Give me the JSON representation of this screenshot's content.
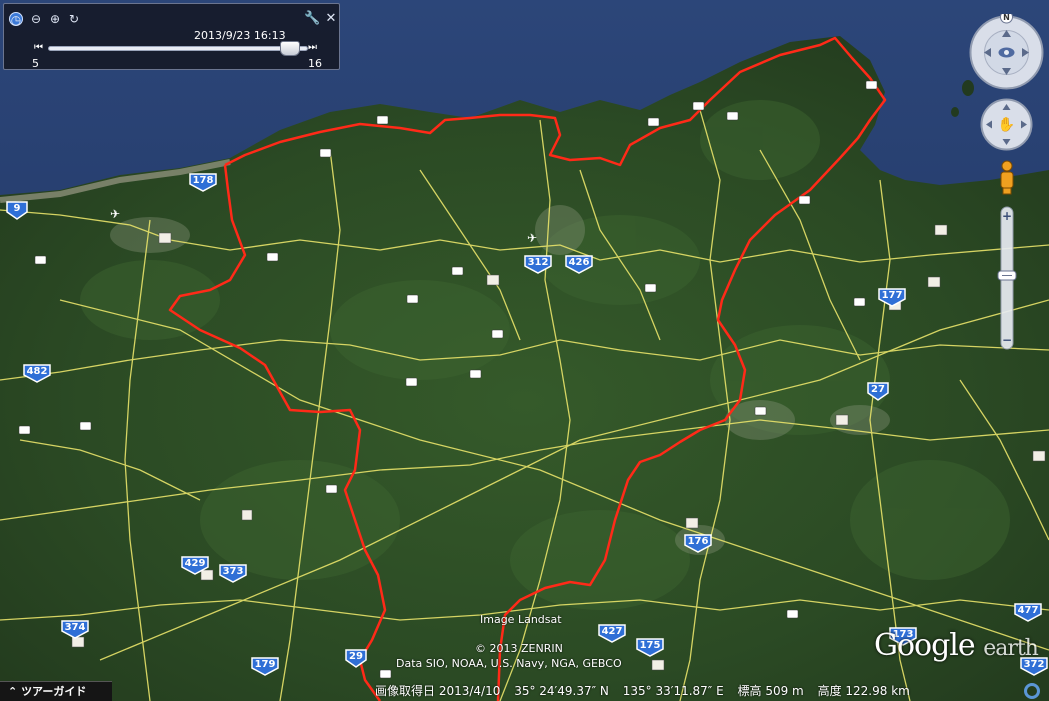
{
  "time_slider": {
    "date": "2013/9/23  16:13",
    "min_label": "5",
    "max_label": "16",
    "position": 0.93
  },
  "markers": {
    "routes": [
      "9",
      "178",
      "312",
      "426",
      "177",
      "482",
      "27",
      "429",
      "373",
      "176",
      "374",
      "179",
      "29",
      "427",
      "175",
      "173",
      "477",
      "372"
    ]
  },
  "attribution": {
    "landsat": "Image Landsat",
    "zenrin": "© 2013 ZENRIN",
    "data": "Data SIO, NOAA, U.S. Navy, NGA, GEBCO"
  },
  "logo": {
    "google": "Google",
    "earth": "earth"
  },
  "status": {
    "imagery_date": "画像取得日  2013/4/10",
    "lat": "35°  24′49.37″  N",
    "lon": "135°  33′11.87″  E",
    "elevation": "標高   509 m",
    "eye_alt": "高度  122.98 km"
  },
  "tour_guide": {
    "label": "ツアーガイド"
  },
  "colors": {
    "boundary": "#ff2a18",
    "road": "#e8e36a",
    "sea": "#22386a",
    "land": "#2b4a24"
  }
}
